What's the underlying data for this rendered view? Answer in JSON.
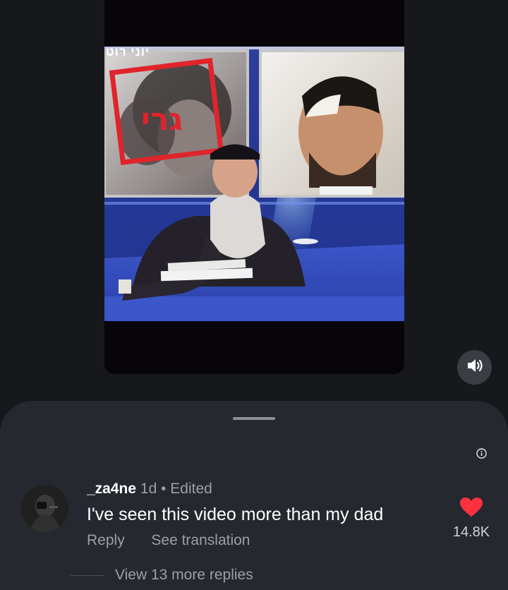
{
  "video": {
    "overlay_hebrew": "יוני רוט",
    "stamp_text": "גרי",
    "mute_icon": "speaker-volume-icon"
  },
  "sheet": {
    "info_icon": "info-icon"
  },
  "comment": {
    "username": "_za4ne",
    "age": "1d",
    "separator": "•",
    "edited": "Edited",
    "text": "I've seen this video more than my dad",
    "reply_label": "Reply",
    "translate_label": "See translation",
    "like_icon": "heart-icon",
    "like_count": "14.8K",
    "like_color": "#ff3040",
    "view_replies_label": "View 13 more replies"
  }
}
